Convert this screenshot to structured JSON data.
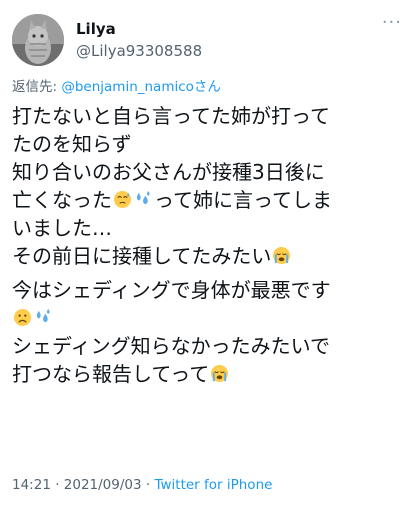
{
  "user": {
    "display_name": "Lilya",
    "handle": "@Lilya93308588",
    "more_label": "···"
  },
  "reply": {
    "prefix": "返信先: ",
    "mention": "@benjamin_namico",
    "suffix": "さん"
  },
  "tweet": {
    "line1": "打たないと自ら言ってた姉が打って",
    "line2": "たのを知らず",
    "line3": "知り合いのお父さんが接種3日後に",
    "line4a": "亡くなった",
    "line4b": "って姉に言ってしま",
    "line5": "いました…",
    "line6": "その前日に接種してたみたい",
    "line7": "今はシェディングで身体が最悪です",
    "line9": "シェディング知らなかったみたいで",
    "line10": "打つなら報告してって"
  },
  "footer": {
    "time": "14:21",
    "separator": " · ",
    "date": "2021/09/03",
    "source": "Twitter for iPhone"
  }
}
